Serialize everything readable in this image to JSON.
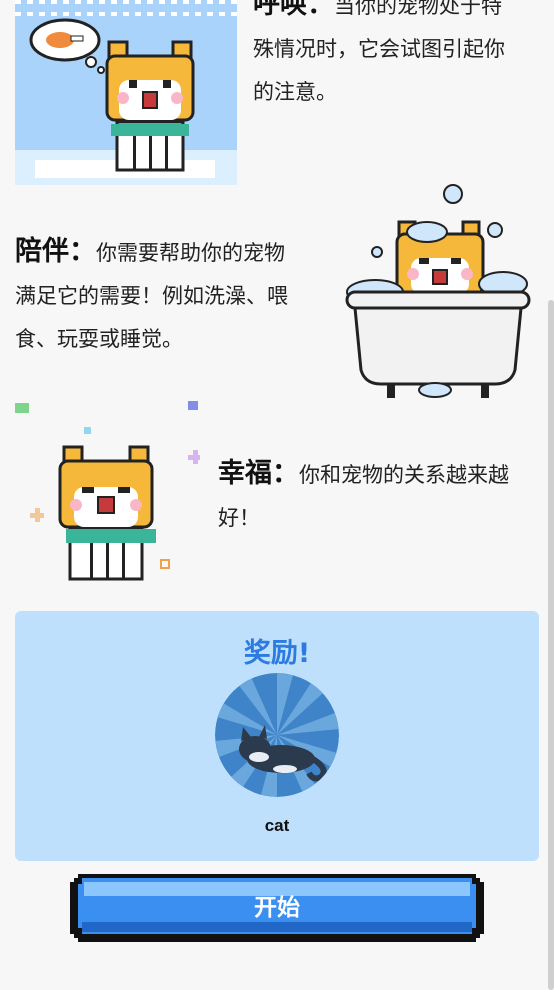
{
  "sections": {
    "call": {
      "title": "呼唤：",
      "line1": "当你的宠物处于特",
      "line2": "殊情况时，它会试图引起你",
      "line3": "的注意。"
    },
    "company": {
      "title": "陪伴：",
      "line1": "你需要帮助你的宠物",
      "line2": "满足它的需要！例如洗澡、喂",
      "line3": "食、玩耍或睡觉。"
    },
    "happy": {
      "title": "幸福：",
      "line1": "你和宠物的关系越来越",
      "line2": "好！"
    }
  },
  "reward": {
    "title": "奖励!",
    "pet_name": "cat"
  },
  "start_button": {
    "label": "开始"
  },
  "colors": {
    "accent": "#2c7be0",
    "card_bg": "#bfe0fc",
    "button": "#3a8ff0"
  }
}
